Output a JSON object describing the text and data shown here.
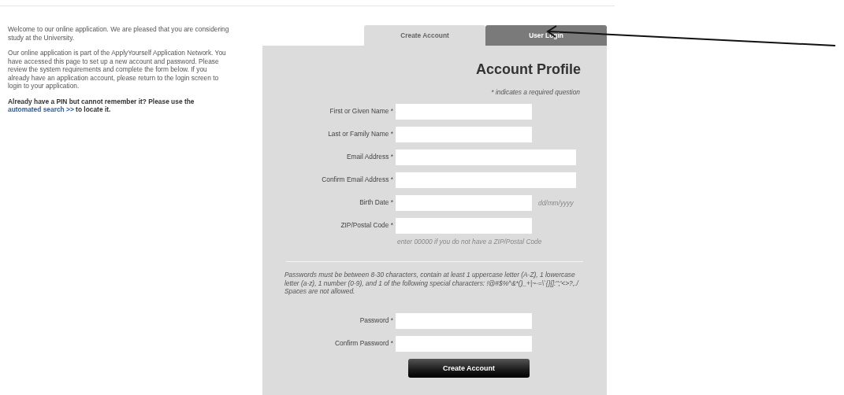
{
  "intro": {
    "paragraphs": [
      "Welcome to our online application. We are pleased that you are considering study at the University.",
      "Our online application is part of the ApplyYourself Application Network. You have accessed this page to set up a new account and password. Please review the system requirements and complete the form below. If you already have an application account, please return to the login screen to login to your application."
    ],
    "pin_note": {
      "before": "Already have a PIN but cannot remember it? Please use the",
      "link": "automated search >>",
      "after": "to locate it."
    }
  },
  "tabs": [
    {
      "label": "Create Account",
      "selected": true
    },
    {
      "label": "User Login",
      "selected": false
    }
  ],
  "form": {
    "title": "Account Profile",
    "required_note": "* indicates a required question",
    "fields": [
      {
        "label": "First or Given Name *",
        "kind": "short"
      },
      {
        "label": "Last or Family Name *",
        "kind": "short"
      },
      {
        "label": "Email Address *",
        "kind": "long"
      },
      {
        "label": "Confirm Email Address *",
        "kind": "long"
      },
      {
        "label": "Birth Date *",
        "kind": "short",
        "hint": {
          "text": "dd/mm/yyyy",
          "kind": "beside"
        }
      },
      {
        "label": "ZIP/Postal Code *",
        "kind": "short",
        "hint": {
          "text": "enter 00000 if you do not have a ZIP/Postal Code",
          "kind": "below"
        }
      }
    ],
    "password_rules": "Passwords must be between 8-30 characters, contain at least 1 uppercase letter (A-Z), 1 lowercase letter (a-z), 1 number (0-9), and 1 of the following special characters: !@#$%^&*()_+|~-=\\`{}[]:\";'<>?,./ Spaces are not allowed.",
    "password_fields": [
      {
        "label": "Password *"
      },
      {
        "label": "Confirm Password *"
      }
    ],
    "submit": "Create Account"
  }
}
